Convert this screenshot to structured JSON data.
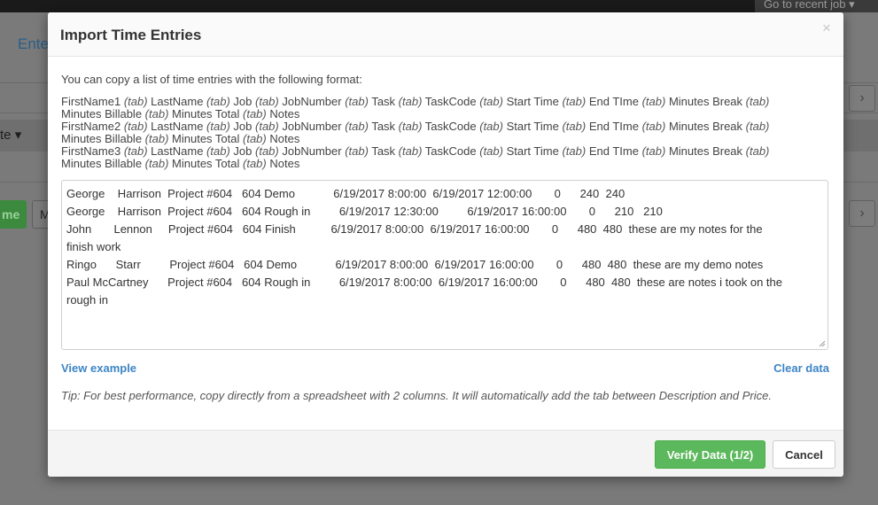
{
  "background": {
    "recent_job": "Go to recent job",
    "page_title": "Ente",
    "select_text": "te",
    "green_button": "me",
    "m_button": "M",
    "chevron_right": "›",
    "chevron_down": "▾"
  },
  "modal": {
    "title": "Import Time Entries",
    "close_symbol": "×",
    "intro": "You can copy a list of time entries with the following format:",
    "format_lines": [
      {
        "line1": [
          {
            "w": "FirstName1",
            "t": "(tab)"
          },
          {
            "w": "LastName",
            "t": "(tab)"
          },
          {
            "w": "Job",
            "t": "(tab)"
          },
          {
            "w": "JobNumber",
            "t": "(tab)"
          },
          {
            "w": "Task",
            "t": "(tab)"
          },
          {
            "w": "TaskCode",
            "t": "(tab)"
          },
          {
            "w": "Start Time",
            "t": "(tab)"
          },
          {
            "w": "End TIme",
            "t": "(tab)"
          },
          {
            "w": "Minutes Break",
            "t": "(tab)"
          }
        ],
        "line2": [
          {
            "w": "Minutes Billable",
            "t": "(tab)"
          },
          {
            "w": "Minutes Total",
            "t": "(tab)"
          },
          {
            "w": "Notes",
            "t": ""
          }
        ]
      },
      {
        "line1": [
          {
            "w": "FirstName2",
            "t": "(tab)"
          },
          {
            "w": "LastName",
            "t": "(tab)"
          },
          {
            "w": "Job",
            "t": "(tab)"
          },
          {
            "w": "JobNumber",
            "t": "(tab)"
          },
          {
            "w": "Task",
            "t": "(tab)"
          },
          {
            "w": "TaskCode",
            "t": "(tab)"
          },
          {
            "w": "Start Time",
            "t": "(tab)"
          },
          {
            "w": "End TIme",
            "t": "(tab)"
          },
          {
            "w": "Minutes Break",
            "t": "(tab)"
          }
        ],
        "line2": [
          {
            "w": "Minutes Billable",
            "t": "(tab)"
          },
          {
            "w": "Minutes Total",
            "t": "(tab)"
          },
          {
            "w": "Notes",
            "t": ""
          }
        ]
      },
      {
        "line1": [
          {
            "w": "FirstName3",
            "t": "(tab)"
          },
          {
            "w": "LastName",
            "t": "(tab)"
          },
          {
            "w": "Job",
            "t": "(tab)"
          },
          {
            "w": "JobNumber",
            "t": "(tab)"
          },
          {
            "w": "Task",
            "t": "(tab)"
          },
          {
            "w": "TaskCode",
            "t": "(tab)"
          },
          {
            "w": "Start Time",
            "t": "(tab)"
          },
          {
            "w": "End TIme",
            "t": "(tab)"
          },
          {
            "w": "Minutes Break",
            "t": "(tab)"
          }
        ],
        "line2": [
          {
            "w": "Minutes Billable",
            "t": "(tab)"
          },
          {
            "w": "Minutes Total",
            "t": "(tab)"
          },
          {
            "w": "Notes",
            "t": ""
          }
        ]
      }
    ],
    "data_lines": [
      "George    Harrison  Project #604   604 Demo            6/19/2017 8:00:00  6/19/2017 12:00:00       0      240  240",
      "George    Harrison  Project #604   604 Rough in         6/19/2017 12:30:00         6/19/2017 16:00:00       0      210   210",
      "John       Lennon     Project #604   604 Finish           6/19/2017 8:00:00  6/19/2017 16:00:00       0      480  480  these are my notes for the",
      "finish work",
      "Ringo      Starr         Project #604   604 Demo            6/19/2017 8:00:00  6/19/2017 16:00:00       0      480  480  these are my demo notes",
      "Paul McCartney      Project #604   604 Rough in         6/19/2017 8:00:00  6/19/2017 16:00:00       0      480  480  these are notes i took on the",
      "rough in"
    ],
    "view_example": "View example",
    "clear_data": "Clear data",
    "tip": "Tip: For best performance, copy directly from a spreadsheet with 2 columns. It will automatically add the tab between Description and Price.",
    "verify_button": "Verify Data (1/2)",
    "cancel_button": "Cancel"
  }
}
